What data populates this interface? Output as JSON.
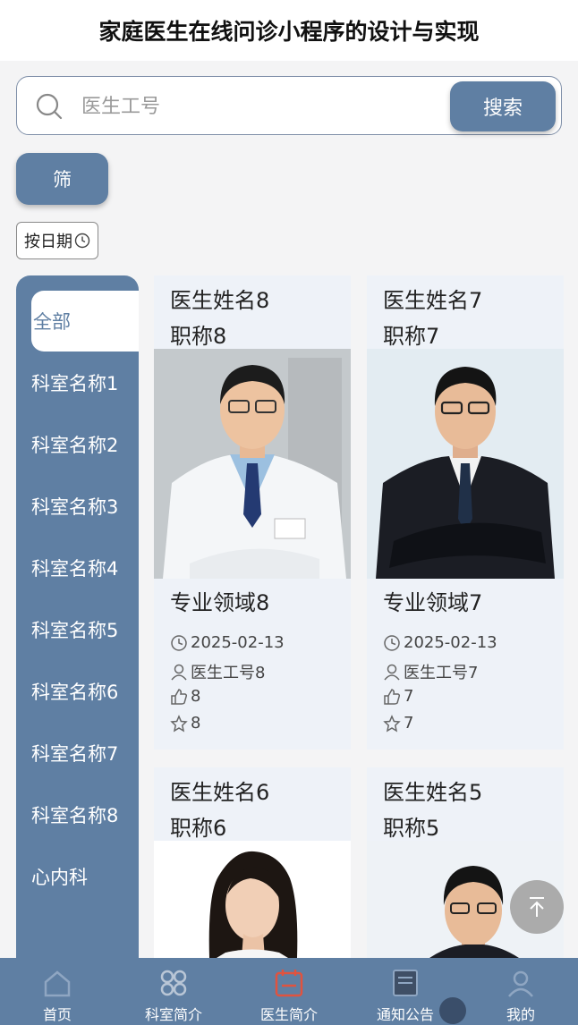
{
  "title": "家庭医生在线问诊小程序的设计与实现",
  "search": {
    "placeholder": "医生工号",
    "button_label": "搜索"
  },
  "filter_label": "筛",
  "sort_label": "按日期",
  "sidebar": {
    "items": [
      {
        "label": "全部",
        "active": true
      },
      {
        "label": "科室名称1"
      },
      {
        "label": "科室名称2"
      },
      {
        "label": "科室名称3"
      },
      {
        "label": "科室名称4"
      },
      {
        "label": "科室名称5"
      },
      {
        "label": "科室名称6"
      },
      {
        "label": "科室名称7"
      },
      {
        "label": "科室名称8"
      },
      {
        "label": "心内科"
      }
    ]
  },
  "cards": [
    {
      "name": "医生姓名8",
      "title": "职称8",
      "field": "专业领域8",
      "date": "2025-02-13",
      "doctor_id": "医生工号8",
      "likes": "8",
      "favorites": "8"
    },
    {
      "name": "医生姓名7",
      "title": "职称7",
      "field": "专业领域7",
      "date": "2025-02-13",
      "doctor_id": "医生工号7",
      "likes": "7",
      "favorites": "7"
    },
    {
      "name": "医生姓名6",
      "title": "职称6"
    },
    {
      "name": "医生姓名5",
      "title": "职称5"
    }
  ],
  "tabbar": {
    "items": [
      {
        "label": "首页",
        "icon": "home-icon"
      },
      {
        "label": "科室简介",
        "icon": "department-icon"
      },
      {
        "label": "医生简介",
        "icon": "doctor-calendar-icon",
        "active": true
      },
      {
        "label": "通知公告",
        "icon": "notice-icon"
      },
      {
        "label": "我的",
        "icon": "profile-icon"
      }
    ]
  },
  "colors": {
    "primary": "#5f7fa3",
    "active_tab_icon": "#e0533f",
    "card_bg": "#eef2f8"
  }
}
